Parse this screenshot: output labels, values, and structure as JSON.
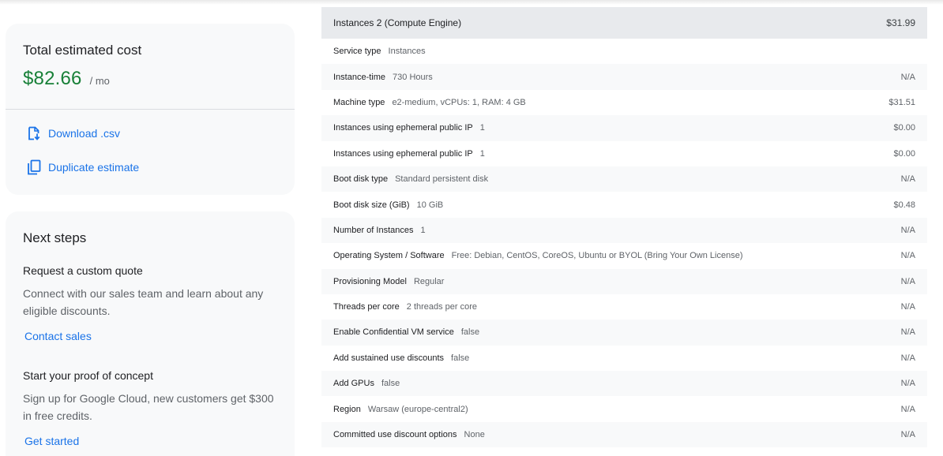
{
  "summary": {
    "title": "Total estimated cost",
    "amount": "$82.66",
    "unit": "/ mo",
    "download_label": "Download .csv",
    "duplicate_label": "Duplicate estimate",
    "download_icon": "download-file-icon",
    "duplicate_icon": "copy-icon",
    "accent_color": "#1a73e8",
    "amount_color": "#188038"
  },
  "next_steps": {
    "title": "Next steps",
    "quote": {
      "heading": "Request a custom quote",
      "text": "Connect with our sales team and learn about any eligible discounts.",
      "link": "Contact sales"
    },
    "poc": {
      "heading": "Start your proof of concept",
      "text": "Sign up for Google Cloud, new customers get $300 in free credits.",
      "link": "Get started"
    }
  },
  "details": {
    "title": "Instances 2 (Compute Engine)",
    "price": "$31.99",
    "rows": [
      {
        "label": "Service type",
        "value": "Instances",
        "price": ""
      },
      {
        "label": "Instance-time",
        "value": "730 Hours",
        "price": "N/A"
      },
      {
        "label": "Machine type",
        "value": "e2-medium, vCPUs: 1, RAM: 4 GB",
        "price": "$31.51"
      },
      {
        "label": "Instances using ephemeral public IP",
        "value": "1",
        "price": "$0.00"
      },
      {
        "label": "Instances using ephemeral public IP",
        "value": "1",
        "price": "$0.00"
      },
      {
        "label": "Boot disk type",
        "value": "Standard persistent disk",
        "price": "N/A"
      },
      {
        "label": "Boot disk size (GiB)",
        "value": "10 GiB",
        "price": "$0.48"
      },
      {
        "label": "Number of Instances",
        "value": "1",
        "price": "N/A"
      },
      {
        "label": "Operating System / Software",
        "value": "Free: Debian, CentOS, CoreOS, Ubuntu or BYOL (Bring Your Own License)",
        "price": "N/A"
      },
      {
        "label": "Provisioning Model",
        "value": "Regular",
        "price": "N/A"
      },
      {
        "label": "Threads per core",
        "value": "2 threads per core",
        "price": "N/A"
      },
      {
        "label": "Enable Confidential VM service",
        "value": "false",
        "price": "N/A"
      },
      {
        "label": "Add sustained use discounts",
        "value": "false",
        "price": "N/A"
      },
      {
        "label": "Add GPUs",
        "value": "false",
        "price": "N/A"
      },
      {
        "label": "Region",
        "value": "Warsaw (europe-central2)",
        "price": "N/A"
      },
      {
        "label": "Committed use discount options",
        "value": "None",
        "price": "N/A"
      }
    ]
  }
}
